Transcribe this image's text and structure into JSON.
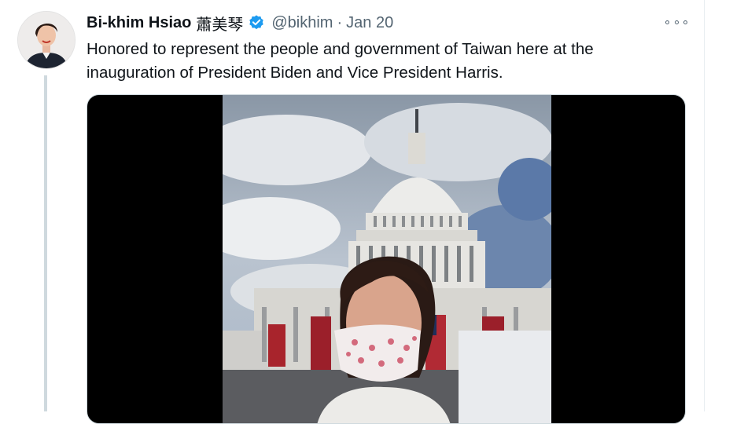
{
  "tweet": {
    "author_name": "Bi-khim Hsiao",
    "author_name_cjk": "蕭美琴",
    "handle": "@bikhim",
    "separator": "·",
    "date": "Jan 20",
    "text": "Honored to represent the people and government of Taiwan here at the inauguration of President Biden and Vice President Harris."
  },
  "icons": {
    "verified": "verified-badge-icon",
    "more": "more-options-icon"
  },
  "colors": {
    "verified_blue": "#1d9bf0",
    "secondary_text": "#536471",
    "primary_text": "#0f1419",
    "thread_line": "#cfd9de"
  }
}
